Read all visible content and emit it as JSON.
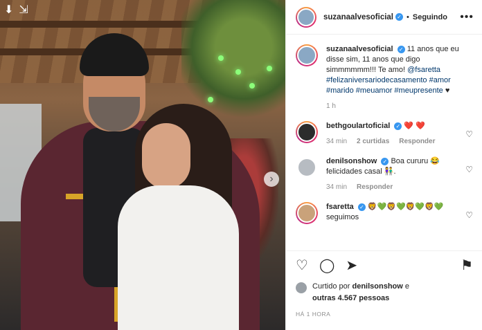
{
  "header": {
    "username": "suzanaalvesoficial",
    "verified_mark": "✓",
    "separator": "•",
    "follow_status": "Seguindo",
    "more": "•••"
  },
  "caption": {
    "username": "suzanaalvesoficial",
    "text": "11 anos que eu disse sim, 11 anos que digo simmmmmm!!! Te amo!",
    "mention": "@fsaretta",
    "hashtags": "#felizaniversariodecasamento #amor #marido #meuamor #meupresente",
    "emoji": "♥",
    "time": "1 h"
  },
  "comments": [
    {
      "username": "bethgoulartoficial",
      "text": "",
      "emoji": "❤️ ❤️",
      "time": "34 min",
      "likes": "2 curtidas",
      "reply": "Responder"
    },
    {
      "username": "denilsonshow",
      "text": "Boa cururu 😂 felicidades casal 👫.",
      "time": "34 min",
      "reply": "Responder"
    },
    {
      "username": "fsaretta",
      "text": "🦁💚🦁💚🦁💚🦁💚",
      "text2": "seguimos",
      "time": "",
      "reply": ""
    }
  ],
  "actions": {
    "like_icon": "heart-icon",
    "comment_icon": "comment-icon",
    "share_icon": "share-icon",
    "save_icon": "bookmark-icon"
  },
  "likes": {
    "prefix": "Curtido por",
    "user": "denilsonshow",
    "connector": "e",
    "others": "outras 4.567 pessoas"
  },
  "timestamp": "HÁ 1 HORA",
  "colors": {
    "verified": "#3897f0",
    "tag": "#00376b",
    "heart": "#ed4956"
  }
}
